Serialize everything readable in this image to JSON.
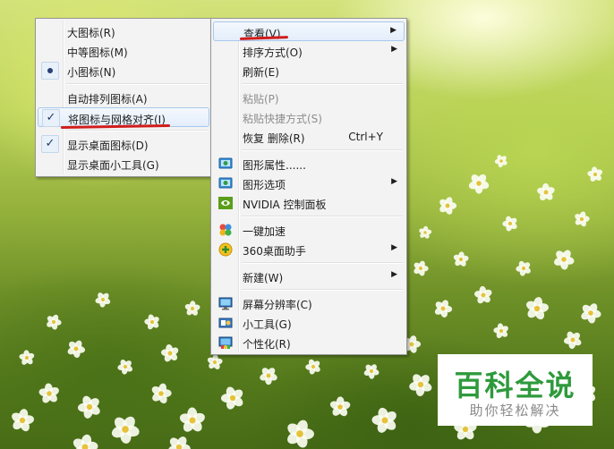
{
  "view_submenu": {
    "items": [
      {
        "label": "大图标(R)",
        "state": "none"
      },
      {
        "label": "中等图标(M)",
        "state": "none"
      },
      {
        "label": "小图标(N)",
        "state": "radio-selected"
      },
      {
        "label": "自动排列图标(A)",
        "state": "none"
      },
      {
        "label": "将图标与网格对齐(I)",
        "state": "checked",
        "highlighted": true
      },
      {
        "label": "显示桌面图标(D)",
        "state": "checked"
      },
      {
        "label": "显示桌面小工具(G)",
        "state": "none"
      }
    ]
  },
  "context_menu": {
    "items": [
      {
        "label": "查看(V)",
        "submenu": true,
        "highlighted": true
      },
      {
        "label": "排序方式(O)",
        "submenu": true
      },
      {
        "label": "刷新(E)"
      },
      {
        "label": "粘贴(P)",
        "disabled": true
      },
      {
        "label": "粘贴快捷方式(S)",
        "disabled": true
      },
      {
        "label": "恢复 删除(R)",
        "shortcut": "Ctrl+Y"
      },
      {
        "label": "图形属性......",
        "icon": "intel-graphics-icon"
      },
      {
        "label": "图形选项",
        "icon": "intel-graphics-icon",
        "submenu": true
      },
      {
        "label": "NVIDIA 控制面板",
        "icon": "nvidia-icon"
      },
      {
        "label": "一键加速",
        "icon": "360-accelerate-icon"
      },
      {
        "label": "360桌面助手",
        "icon": "360-desktop-icon",
        "submenu": true
      },
      {
        "label": "新建(W)",
        "submenu": true
      },
      {
        "label": "屏幕分辨率(C)",
        "icon": "display-resolution-icon"
      },
      {
        "label": "小工具(G)",
        "icon": "gadgets-icon"
      },
      {
        "label": "个性化(R)",
        "icon": "personalize-icon"
      }
    ],
    "submenu_arrow": "▶",
    "check_glyph": "✓"
  },
  "watermark": {
    "title": "百科全说",
    "subtitle": "助你轻松解决"
  },
  "colors": {
    "menu_bg": "#f3f3f3",
    "highlight_border": "#a8c8ec",
    "annotation_red": "#d11d1d",
    "watermark_green": "#2e9a3c"
  }
}
